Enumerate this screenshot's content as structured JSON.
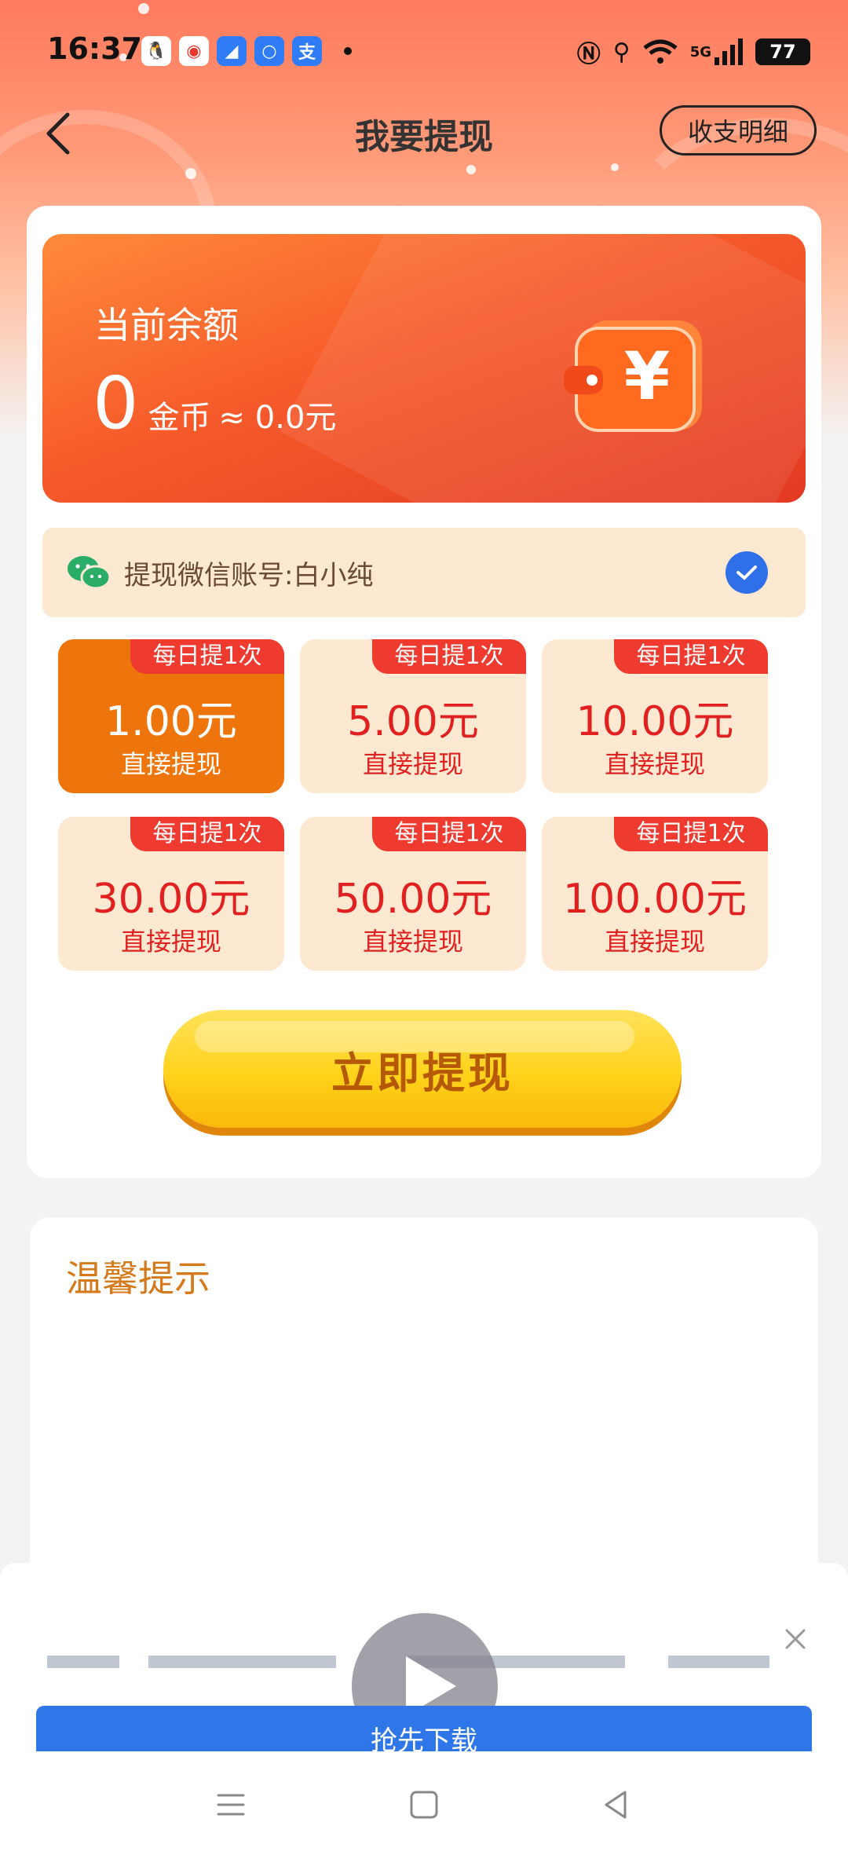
{
  "status_bar": {
    "time": "16:37",
    "notification_icons": [
      "qq-icon",
      "weibo-icon",
      "app-icon",
      "app-icon",
      "alipay-icon"
    ],
    "alipay_glyph": "支",
    "network": "5G",
    "battery": "77"
  },
  "header": {
    "title": "我要提现",
    "detail_button": "收支明细"
  },
  "balance": {
    "label": "当前余额",
    "value": "0",
    "unit": "金币",
    "approx": "≈ 0.0元"
  },
  "wechat_account": {
    "label": "提现微信账号:白小纯",
    "checked": true
  },
  "options": [
    {
      "tag": "每日提1次",
      "amount": "1.00元",
      "sub": "直接提现",
      "selected": true
    },
    {
      "tag": "每日提1次",
      "amount": "5.00元",
      "sub": "直接提现",
      "selected": false
    },
    {
      "tag": "每日提1次",
      "amount": "10.00元",
      "sub": "直接提现",
      "selected": false
    },
    {
      "tag": "每日提1次",
      "amount": "30.00元",
      "sub": "直接提现",
      "selected": false
    },
    {
      "tag": "每日提1次",
      "amount": "50.00元",
      "sub": "直接提现",
      "selected": false
    },
    {
      "tag": "每日提1次",
      "amount": "100.00元",
      "sub": "直接提现",
      "selected": false
    }
  ],
  "withdraw_button": "立即提现",
  "tips": {
    "title": "温馨提示"
  },
  "ad": {
    "button": "抢先下载"
  },
  "colors": {
    "accent_orange": "#ee740c",
    "price_red": "#e0211f",
    "wechat_green": "#2aae67",
    "check_blue": "#2f6fe8"
  }
}
